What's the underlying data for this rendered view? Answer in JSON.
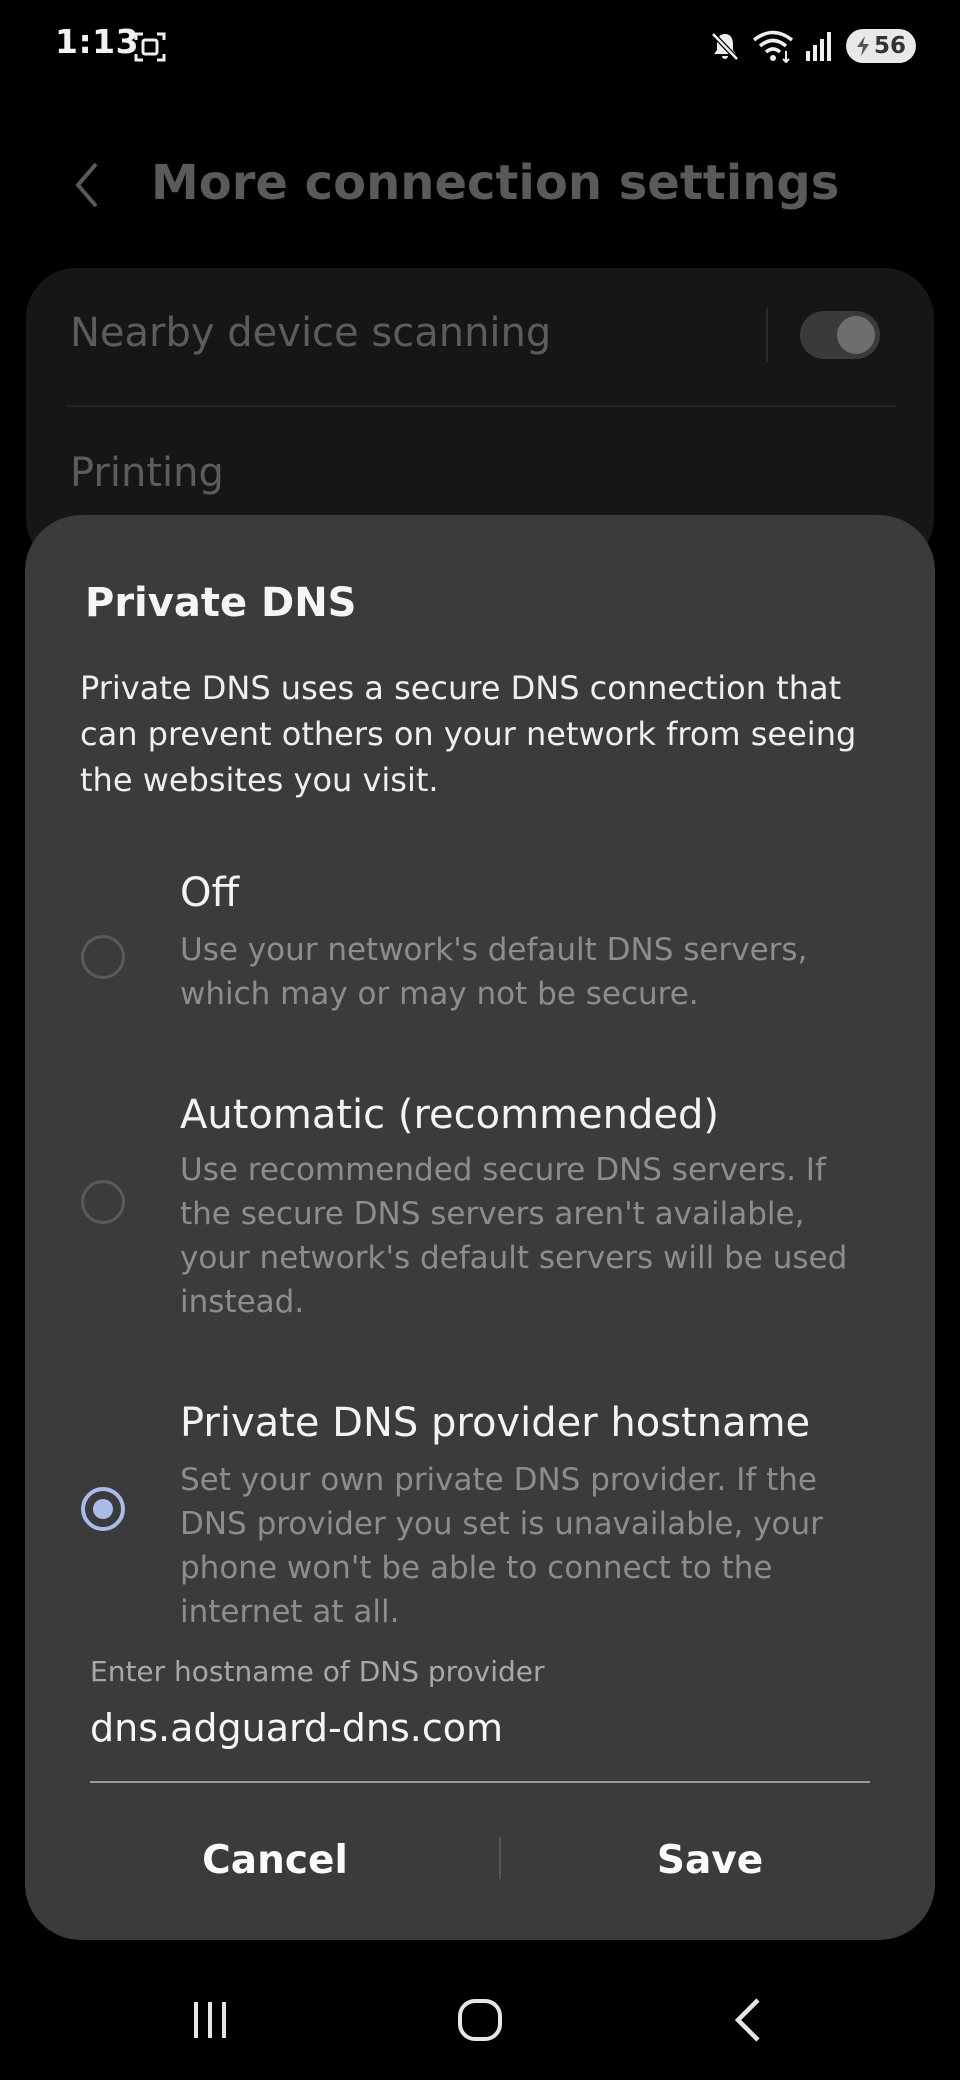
{
  "status_bar": {
    "time": "1:13",
    "battery_level": "56",
    "icons": [
      "screenshot-icon",
      "mute-icon",
      "wifi-icon",
      "signal-icon",
      "battery-icon"
    ]
  },
  "background_page": {
    "title": "More connection settings",
    "rows": [
      {
        "label": "Nearby device scanning",
        "toggle_on": true
      },
      {
        "label": "Printing"
      }
    ]
  },
  "dialog": {
    "title": "Private DNS",
    "description": "Private DNS uses a secure DNS connection that can prevent others on your network from seeing the websites you visit.",
    "options": [
      {
        "label": "Off",
        "description": "Use your network's default DNS servers, which may or may not be secure.",
        "selected": false
      },
      {
        "label": "Automatic (recommended)",
        "description": "Use recommended secure DNS servers. If the secure DNS servers aren't available, your network's default servers will be used instead.",
        "selected": false
      },
      {
        "label": "Private DNS provider hostname",
        "description": "Set your own private DNS provider. If the DNS provider you set is unavailable, your phone won't be able to connect to the internet at all.",
        "selected": true
      }
    ],
    "hostname_input": {
      "label": "Enter hostname of DNS provider",
      "value": "dns.adguard-dns.com"
    },
    "cancel_label": "Cancel",
    "save_label": "Save"
  },
  "colors": {
    "dialog_bg": "#3b3b3b",
    "accent": "#a9bcea",
    "secondary_text": "#8d8d8d"
  }
}
